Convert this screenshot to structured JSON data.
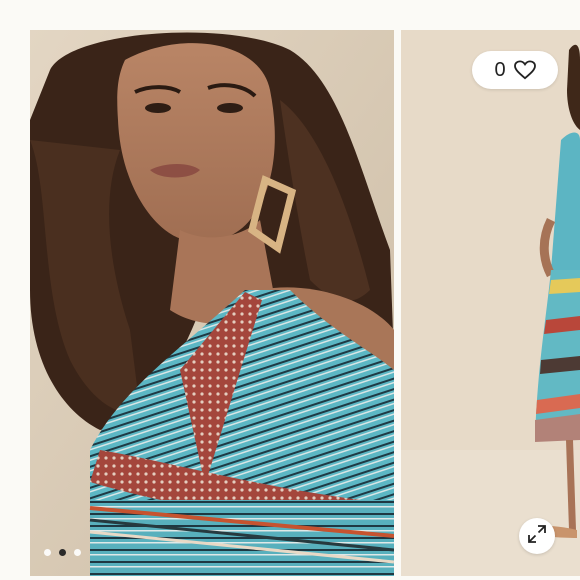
{
  "favorites": {
    "count": "0",
    "icon": "heart-icon"
  },
  "gallery": {
    "slides": [
      {
        "label": "slide-1"
      },
      {
        "label": "slide-2"
      },
      {
        "label": "slide-3"
      }
    ],
    "active_slide": 2,
    "expand_icon": "expand-arrows-icon"
  },
  "colors": {
    "background": "#fbfaf6",
    "pill": "#ffffff",
    "dot_active": "#2a2a2a",
    "dot_inactive": "#ffffff",
    "dress_teal": "#4fb3bf",
    "dress_red": "#a5463b"
  }
}
